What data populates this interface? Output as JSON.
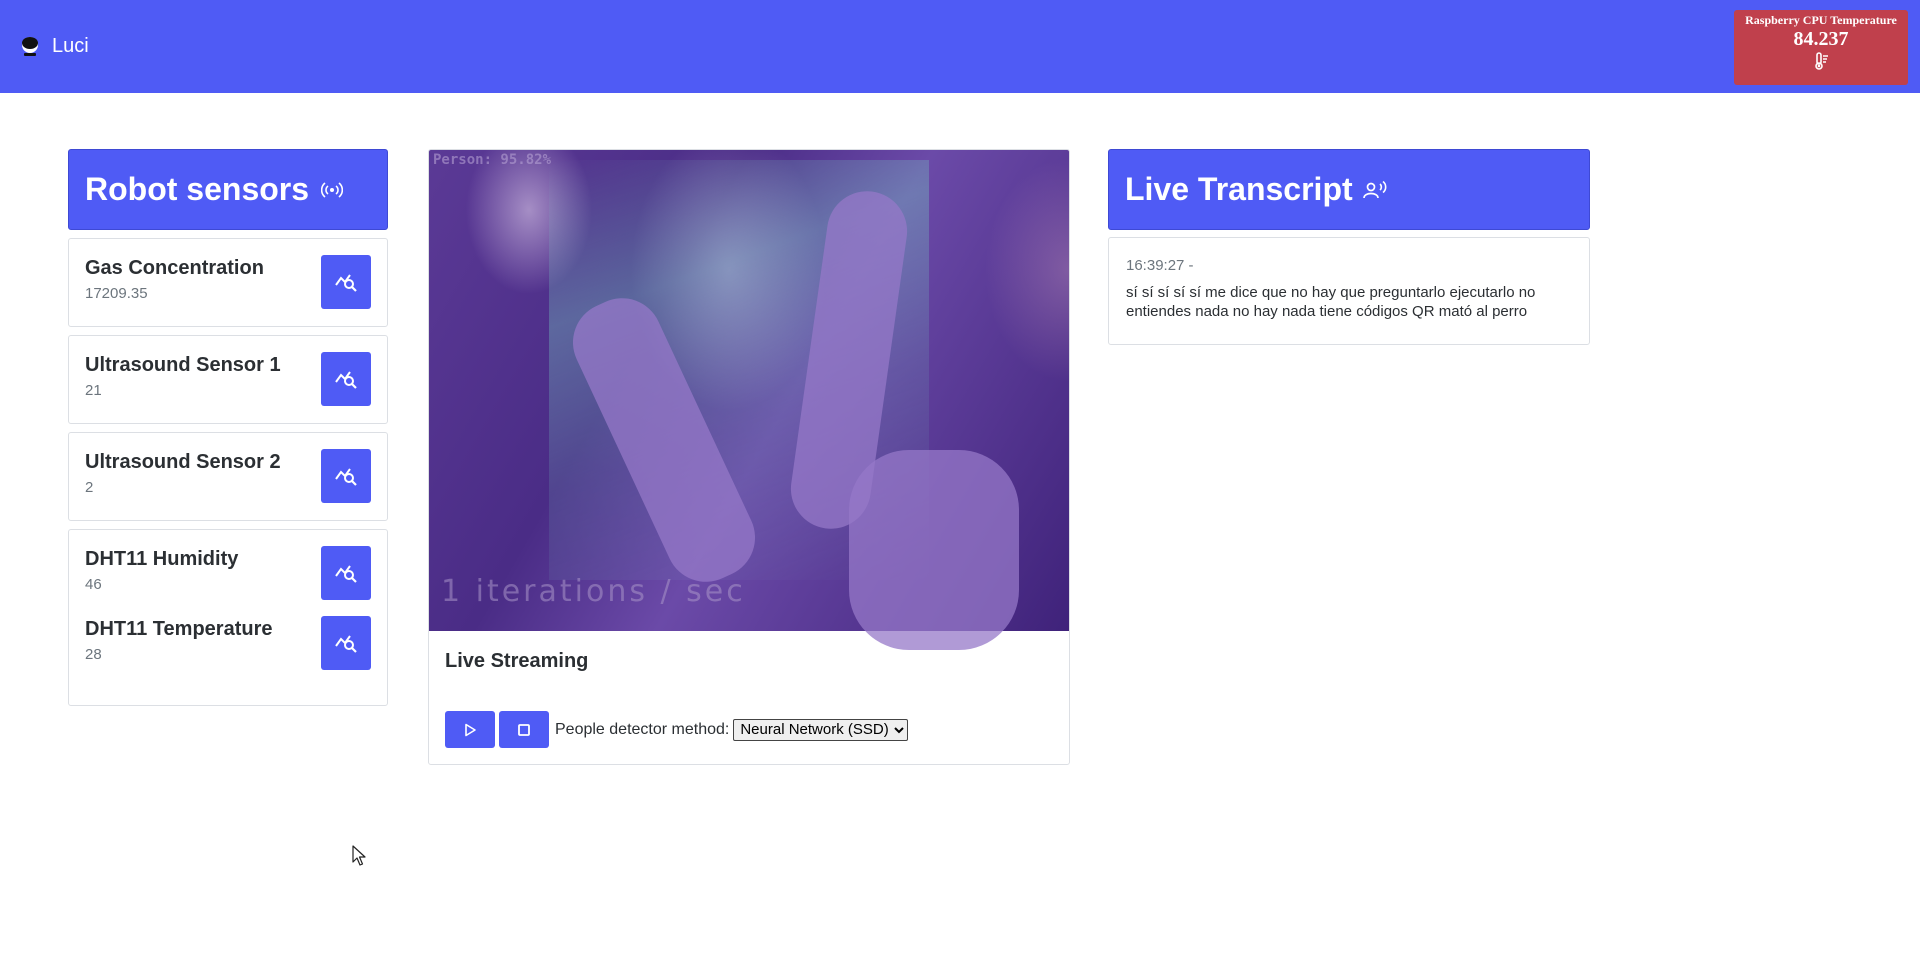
{
  "navbar": {
    "brand": "Luci",
    "cpu_temp": {
      "title": "Raspberry CPU Temperature",
      "value": "84.237",
      "icon": "thermometer-icon"
    }
  },
  "sensors": {
    "title": "Robot sensors",
    "title_icon": "broadcast-icon",
    "items": [
      {
        "name": "Gas Concentration",
        "value": "17209.35"
      },
      {
        "name": "Ultrasound Sensor 1",
        "value": "21"
      },
      {
        "name": "Ultrasound Sensor 2",
        "value": "2"
      },
      {
        "name": "DHT11 Humidity",
        "value": "46"
      },
      {
        "name": "DHT11 Temperature",
        "value": "28"
      }
    ],
    "button_icon": "graph-search-icon"
  },
  "video": {
    "overlay_top": "Person: 95.82%",
    "overlay_iter": "1 iterations / sec",
    "title": "Live Streaming",
    "play_icon": "play-icon",
    "stop_icon": "stop-icon",
    "detector_label": "People detector method:",
    "detector_selected": "Neural Network (SSD)"
  },
  "transcript": {
    "title": "Live Transcript",
    "title_icon": "person-voice-icon",
    "time": "16:39:27 -",
    "text": "sí sí sí sí sí me dice que no hay que preguntarlo ejecutarlo no entiendes nada no hay nada tiene códigos QR mató al perro"
  },
  "colors": {
    "primary": "#4f5bf5",
    "danger": "#c0404c"
  }
}
